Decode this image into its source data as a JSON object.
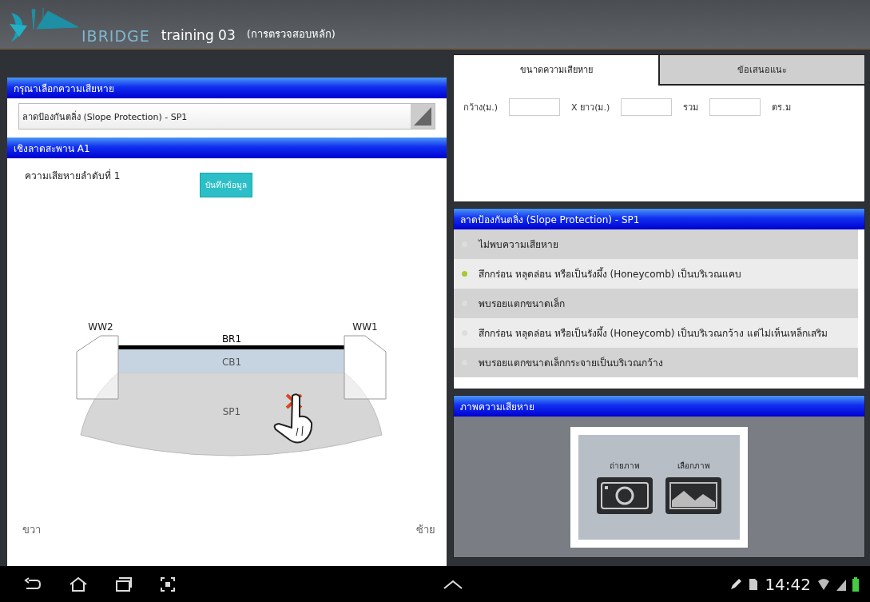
{
  "top_bar": {
    "logo": "IBRIDGE",
    "project": "training 03",
    "mode": "(การตรวจสอบหลัก)"
  },
  "damage_select": {
    "header": "กรุณาเลือกความเสียหาย",
    "value": "ลาดป้องกันตลิ่ง (Slope Protection) - SP1"
  },
  "diagram_panel": {
    "header": "เชิงลาดสะพาน A1",
    "damage_label": "ความเสียหายลำดับที่ 1",
    "save_button": "บันทึกข้อมูล",
    "parts": [
      {
        "kind": "wingwall_left",
        "label": "WW2"
      },
      {
        "kind": "wingwall_right",
        "label": "WW1"
      },
      {
        "kind": "beam",
        "label": "BR1"
      },
      {
        "kind": "cap",
        "label": "CB1"
      },
      {
        "kind": "slope",
        "label": "SP1"
      }
    ],
    "side_right": "ขวา",
    "side_left": "ซ้าย"
  },
  "size_tabs": [
    {
      "label": "ขนาดความเสียหาย",
      "selected": true
    },
    {
      "label": "ข้อเสนอแนะ",
      "selected": false
    }
  ],
  "size_form": [
    {
      "kind": "label",
      "text": "กว้าง(ม.)"
    },
    {
      "kind": "field"
    },
    {
      "kind": "label",
      "text": "X ยาว(ม.)"
    },
    {
      "kind": "field"
    },
    {
      "kind": "label",
      "text": "รวม"
    },
    {
      "kind": "field"
    },
    {
      "kind": "label",
      "text": "ตร.ม"
    }
  ],
  "damage_options": {
    "header": "ลาดป้องกันตลิ่ง (Slope Protection) - SP1",
    "options": [
      {
        "label": "ไม่พบความเสียหาย",
        "selected": false
      },
      {
        "label": "สึกกร่อน หลุดล่อน หรือเป็นรังผึ้ง (Honeycomb) เป็นบริเวณแคบ",
        "selected": true
      },
      {
        "label": "พบรอยแตกขนาดเล็ก",
        "selected": false
      },
      {
        "label": "สึกกร่อน หลุดล่อน หรือเป็นรังผึ้ง (Honeycomb) เป็นบริเวณกว้าง แต่ไม่เห็นเหล็กเสริม",
        "selected": false
      },
      {
        "label": "พบรอยแตกขนาดเล็กกระจายเป็นบริเวณกว้าง",
        "selected": false
      }
    ]
  },
  "photo_panel": {
    "header": "ภาพความเสียหาย",
    "buttons": [
      {
        "kind": "camera",
        "label": "ถ่ายภาพ"
      },
      {
        "kind": "gallery",
        "label": "เลือกภาพ"
      }
    ]
  },
  "system_bar": {
    "time": "14:42"
  }
}
